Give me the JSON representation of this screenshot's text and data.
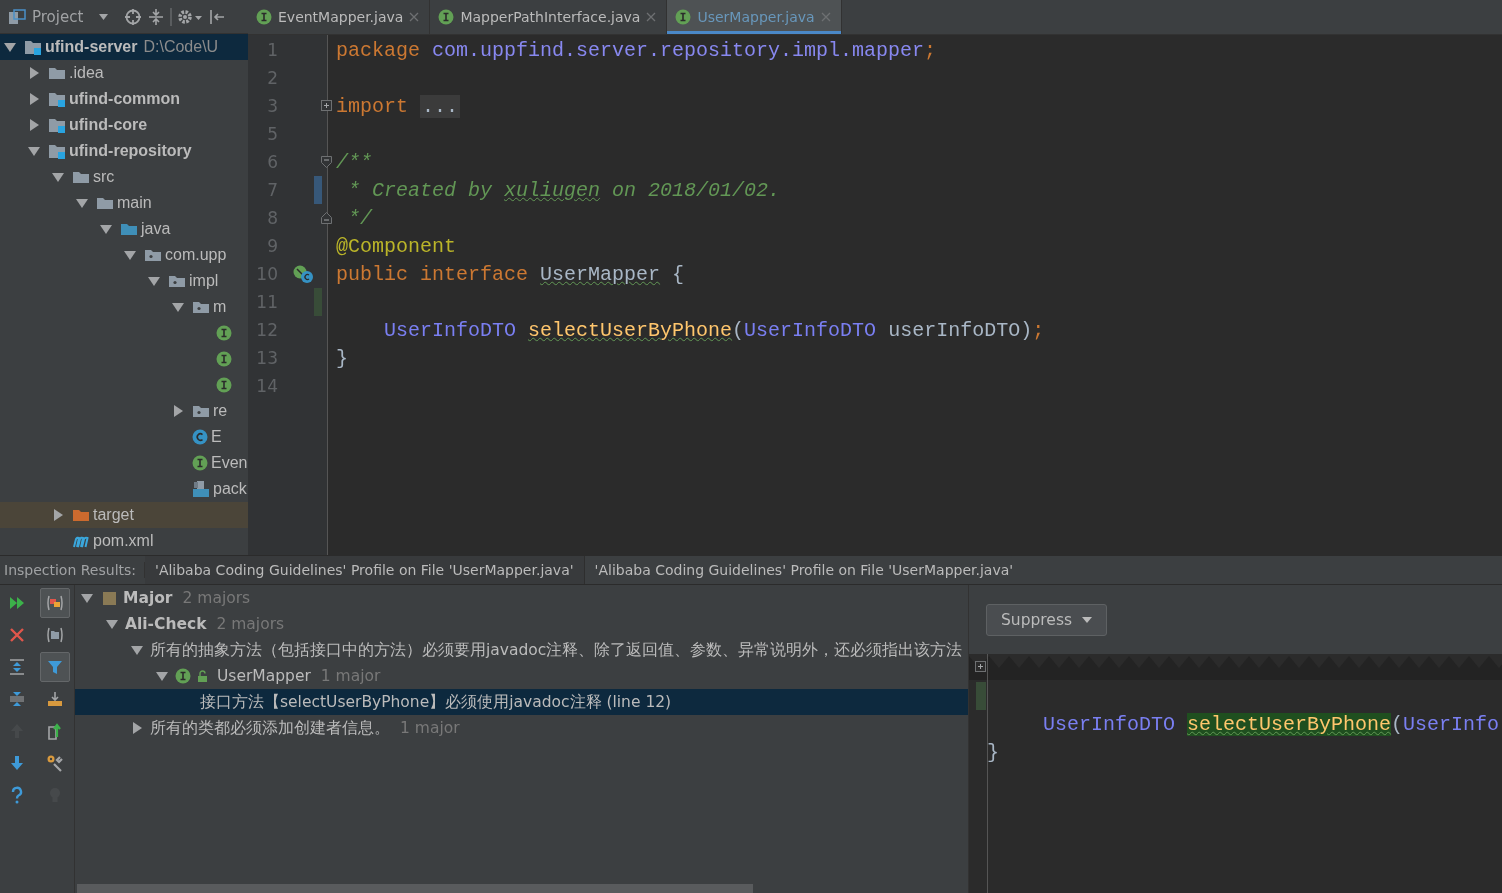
{
  "project_panel": {
    "title": "Project",
    "tree": [
      {
        "label": "ufind-server",
        "path": "D:\\Code\\U",
        "kind": "module",
        "expanded": true,
        "selected": true,
        "children": [
          {
            "label": ".idea",
            "kind": "folder",
            "expanded": false,
            "selected": false
          },
          {
            "label": "ufind-common",
            "kind": "module",
            "expanded": false,
            "selected": false
          },
          {
            "label": "ufind-core",
            "kind": "module",
            "expanded": false,
            "selected": false
          },
          {
            "label": "ufind-repository",
            "kind": "module",
            "expanded": true,
            "selected": false,
            "children": [
              {
                "label": "src",
                "kind": "folder",
                "expanded": true,
                "selected": false,
                "children": [
                  {
                    "label": "main",
                    "kind": "folder",
                    "expanded": true,
                    "selected": false,
                    "children": [
                      {
                        "label": "java",
                        "kind": "source",
                        "expanded": true,
                        "selected": false,
                        "children": [
                          {
                            "label": "com.upp",
                            "kind": "package",
                            "expanded": true,
                            "selected": false,
                            "children": [
                              {
                                "label": "impl",
                                "kind": "package",
                                "expanded": true,
                                "selected": false,
                                "children": [
                                  {
                                    "label": "m",
                                    "kind": "package",
                                    "expanded": true,
                                    "selected": false,
                                    "children": [
                                      {
                                        "kind": "interface",
                                        "selected": false
                                      },
                                      {
                                        "kind": "interface",
                                        "selected": false
                                      },
                                      {
                                        "kind": "interface",
                                        "selected": false
                                      }
                                    ]
                                  },
                                  {
                                    "label": "re",
                                    "kind": "package",
                                    "expanded": false,
                                    "selected": false
                                  },
                                  {
                                    "label": "E",
                                    "kind": "class",
                                    "selected": false
                                  },
                                  {
                                    "label": "Even",
                                    "kind": "interface",
                                    "selected": false
                                  },
                                  {
                                    "label": "pack",
                                    "kind": "package-info",
                                    "selected": false
                                  }
                                ]
                              }
                            ]
                          }
                        ]
                      }
                    ]
                  }
                ]
              },
              {
                "label": "target",
                "kind": "excluded",
                "expanded": false,
                "selected": false
              },
              {
                "label": "pom.xml",
                "kind": "maven",
                "selected": false
              }
            ]
          }
        ]
      }
    ]
  },
  "editor": {
    "tabs": [
      {
        "label": "EventMapper.java",
        "selected": false
      },
      {
        "label": "MapperPathInterface.java",
        "selected": false
      },
      {
        "label": "UserMapper.java",
        "selected": true
      }
    ],
    "lines": [
      {
        "number": "1",
        "tokens": [
          {
            "text": "package ",
            "kind": "keyword"
          },
          {
            "text": "com.uppfind.server.repository.impl.mapper",
            "kind": "package"
          },
          {
            "text": ";",
            "kind": "keyword"
          }
        ]
      },
      {
        "number": "2"
      },
      {
        "number": "3",
        "kind": "folded",
        "tokens": [
          {
            "text": "import ",
            "kind": "keyword"
          },
          {
            "text": "...",
            "kind": "folded"
          }
        ]
      },
      {
        "number": "5"
      },
      {
        "number": "6",
        "kind": "fold-start",
        "tokens": [
          {
            "text": "/**",
            "kind": "doc"
          }
        ]
      },
      {
        "number": "7",
        "kind": "changed",
        "tokens": [
          {
            "text": " * Created by ",
            "kind": "doc"
          },
          {
            "text": "xuliugen",
            "kind": "doc",
            "typo": true
          },
          {
            "text": " on 2018/01/02.",
            "kind": "doc"
          }
        ]
      },
      {
        "number": "8",
        "kind": "fold-end",
        "tokens": [
          {
            "text": " */",
            "kind": "doc"
          }
        ]
      },
      {
        "number": "9",
        "tokens": [
          {
            "text": "@Component",
            "kind": "annotation"
          }
        ]
      },
      {
        "number": "10",
        "kind": "implemented",
        "tokens": [
          {
            "text": "public interface ",
            "kind": "keyword"
          },
          {
            "text": "UserMapper",
            "kind": "plain",
            "typo": true
          },
          {
            "text": " {",
            "kind": "plain"
          }
        ]
      },
      {
        "number": "11",
        "kind": "added"
      },
      {
        "number": "12",
        "indented": true,
        "tokens": [
          {
            "text": "UserInfoDTO ",
            "kind": "type"
          },
          {
            "text": "selectUserByPhone",
            "kind": "method",
            "typo": true
          },
          {
            "text": "(",
            "kind": "plain"
          },
          {
            "text": "UserInfoDTO",
            "kind": "type"
          },
          {
            "text": " userInfoDTO)",
            "kind": "plain"
          },
          {
            "text": ";",
            "kind": "keyword"
          }
        ]
      },
      {
        "number": "13",
        "tokens": [
          {
            "text": "}",
            "kind": "plain"
          }
        ]
      },
      {
        "number": "14"
      }
    ]
  },
  "inspection": {
    "label": "Inspection Results:",
    "tabs": [
      {
        "label": "'Alibaba Coding Guidelines' Profile on File 'UserMapper.java'",
        "selected": true
      },
      {
        "label": "'Alibaba Coding Guidelines' Profile on File 'UserMapper.java'",
        "selected": false
      }
    ],
    "toolbar": [
      {
        "kind": "rerun",
        "on": false,
        "disabled": false
      },
      {
        "kind": "group-severity",
        "on": true,
        "disabled": false
      },
      {
        "kind": "close",
        "on": false,
        "disabled": false
      },
      {
        "kind": "group-directory",
        "on": false,
        "disabled": false
      },
      {
        "kind": "expand",
        "on": false,
        "disabled": false
      },
      {
        "kind": "filter",
        "on": true,
        "disabled": false
      },
      {
        "kind": "collapse",
        "on": false,
        "disabled": false
      },
      {
        "kind": "export",
        "on": false,
        "disabled": false
      },
      {
        "kind": "previous",
        "on": false,
        "disabled": true
      },
      {
        "kind": "open",
        "on": false,
        "disabled": false
      },
      {
        "kind": "next",
        "on": false,
        "disabled": false
      },
      {
        "kind": "settings",
        "on": false,
        "disabled": false
      },
      {
        "kind": "help",
        "on": false,
        "disabled": false
      },
      {
        "kind": "bulb",
        "on": false,
        "disabled": true
      }
    ],
    "tree": [
      {
        "kind": "severity",
        "label": "Major",
        "count": "2 majors",
        "expanded": true,
        "selected": false,
        "children": [
          {
            "kind": "group",
            "label": "Ali-Check",
            "count": "2 majors",
            "expanded": true,
            "selected": false,
            "children": [
              {
                "label": "所有的抽象方法（包括接口中的方法）必须要用javadoc注释、除了返回值、参数、异常说明外，还必须指出该方法",
                "expanded": true,
                "selected": false,
                "children": [
                  {
                    "kind": "file",
                    "label": "UserMapper",
                    "count": "1 major",
                    "expanded": true,
                    "selected": false,
                    "children": [
                      {
                        "label": "接口方法【selectUserByPhone】必须使用javadoc注释 (line 12)",
                        "selected": true
                      }
                    ]
                  }
                ]
              },
              {
                "label": "所有的类都必须添加创建者信息。",
                "count": "1 major",
                "expanded": false,
                "selected": false
              }
            ]
          }
        ]
      }
    ],
    "suppress_button": "Suppress",
    "preview_lines": [
      {
        "indented": true,
        "tokens": [
          {
            "text": "UserInfoDTO ",
            "kind": "type"
          },
          {
            "text": "selectUserByPhone",
            "kind": "method",
            "typo": true,
            "highlighted": true
          },
          {
            "text": "(",
            "kind": "plain"
          },
          {
            "text": "UserInfo",
            "kind": "type"
          }
        ]
      },
      {
        "tokens": [
          {
            "text": "}",
            "kind": "plain"
          }
        ]
      }
    ]
  }
}
